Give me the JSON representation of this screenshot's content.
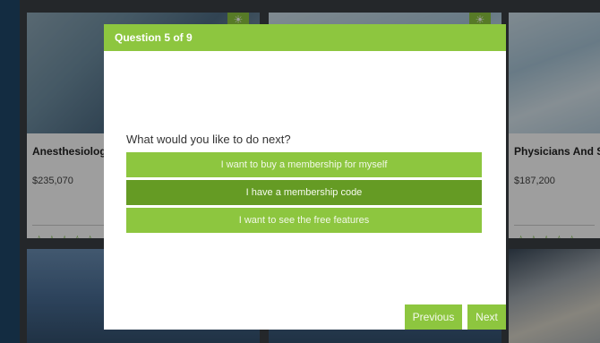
{
  "background_cards": {
    "left": {
      "title": "Anesthesiolog",
      "salary": "$235,070",
      "stars": "☆☆☆☆☆"
    },
    "right": {
      "title": "Physicians And S",
      "salary": "$187,200",
      "stars": "☆☆☆☆☆"
    }
  },
  "icons": {
    "badge": "sun-icon",
    "star": "star-outline-icon"
  },
  "colors": {
    "accent": "#8dc63f",
    "accent_selected": "#659b24",
    "left_strip": "#20486a"
  },
  "modal": {
    "header": "Question 5 of 9",
    "question": "What would you like to do next?",
    "options": [
      {
        "label": "I want to buy a membership for myself",
        "selected": false
      },
      {
        "label": "I have a membership code",
        "selected": true
      },
      {
        "label": "I want to see the free features",
        "selected": false
      }
    ],
    "previous_label": "Previous",
    "next_label": "Next"
  }
}
